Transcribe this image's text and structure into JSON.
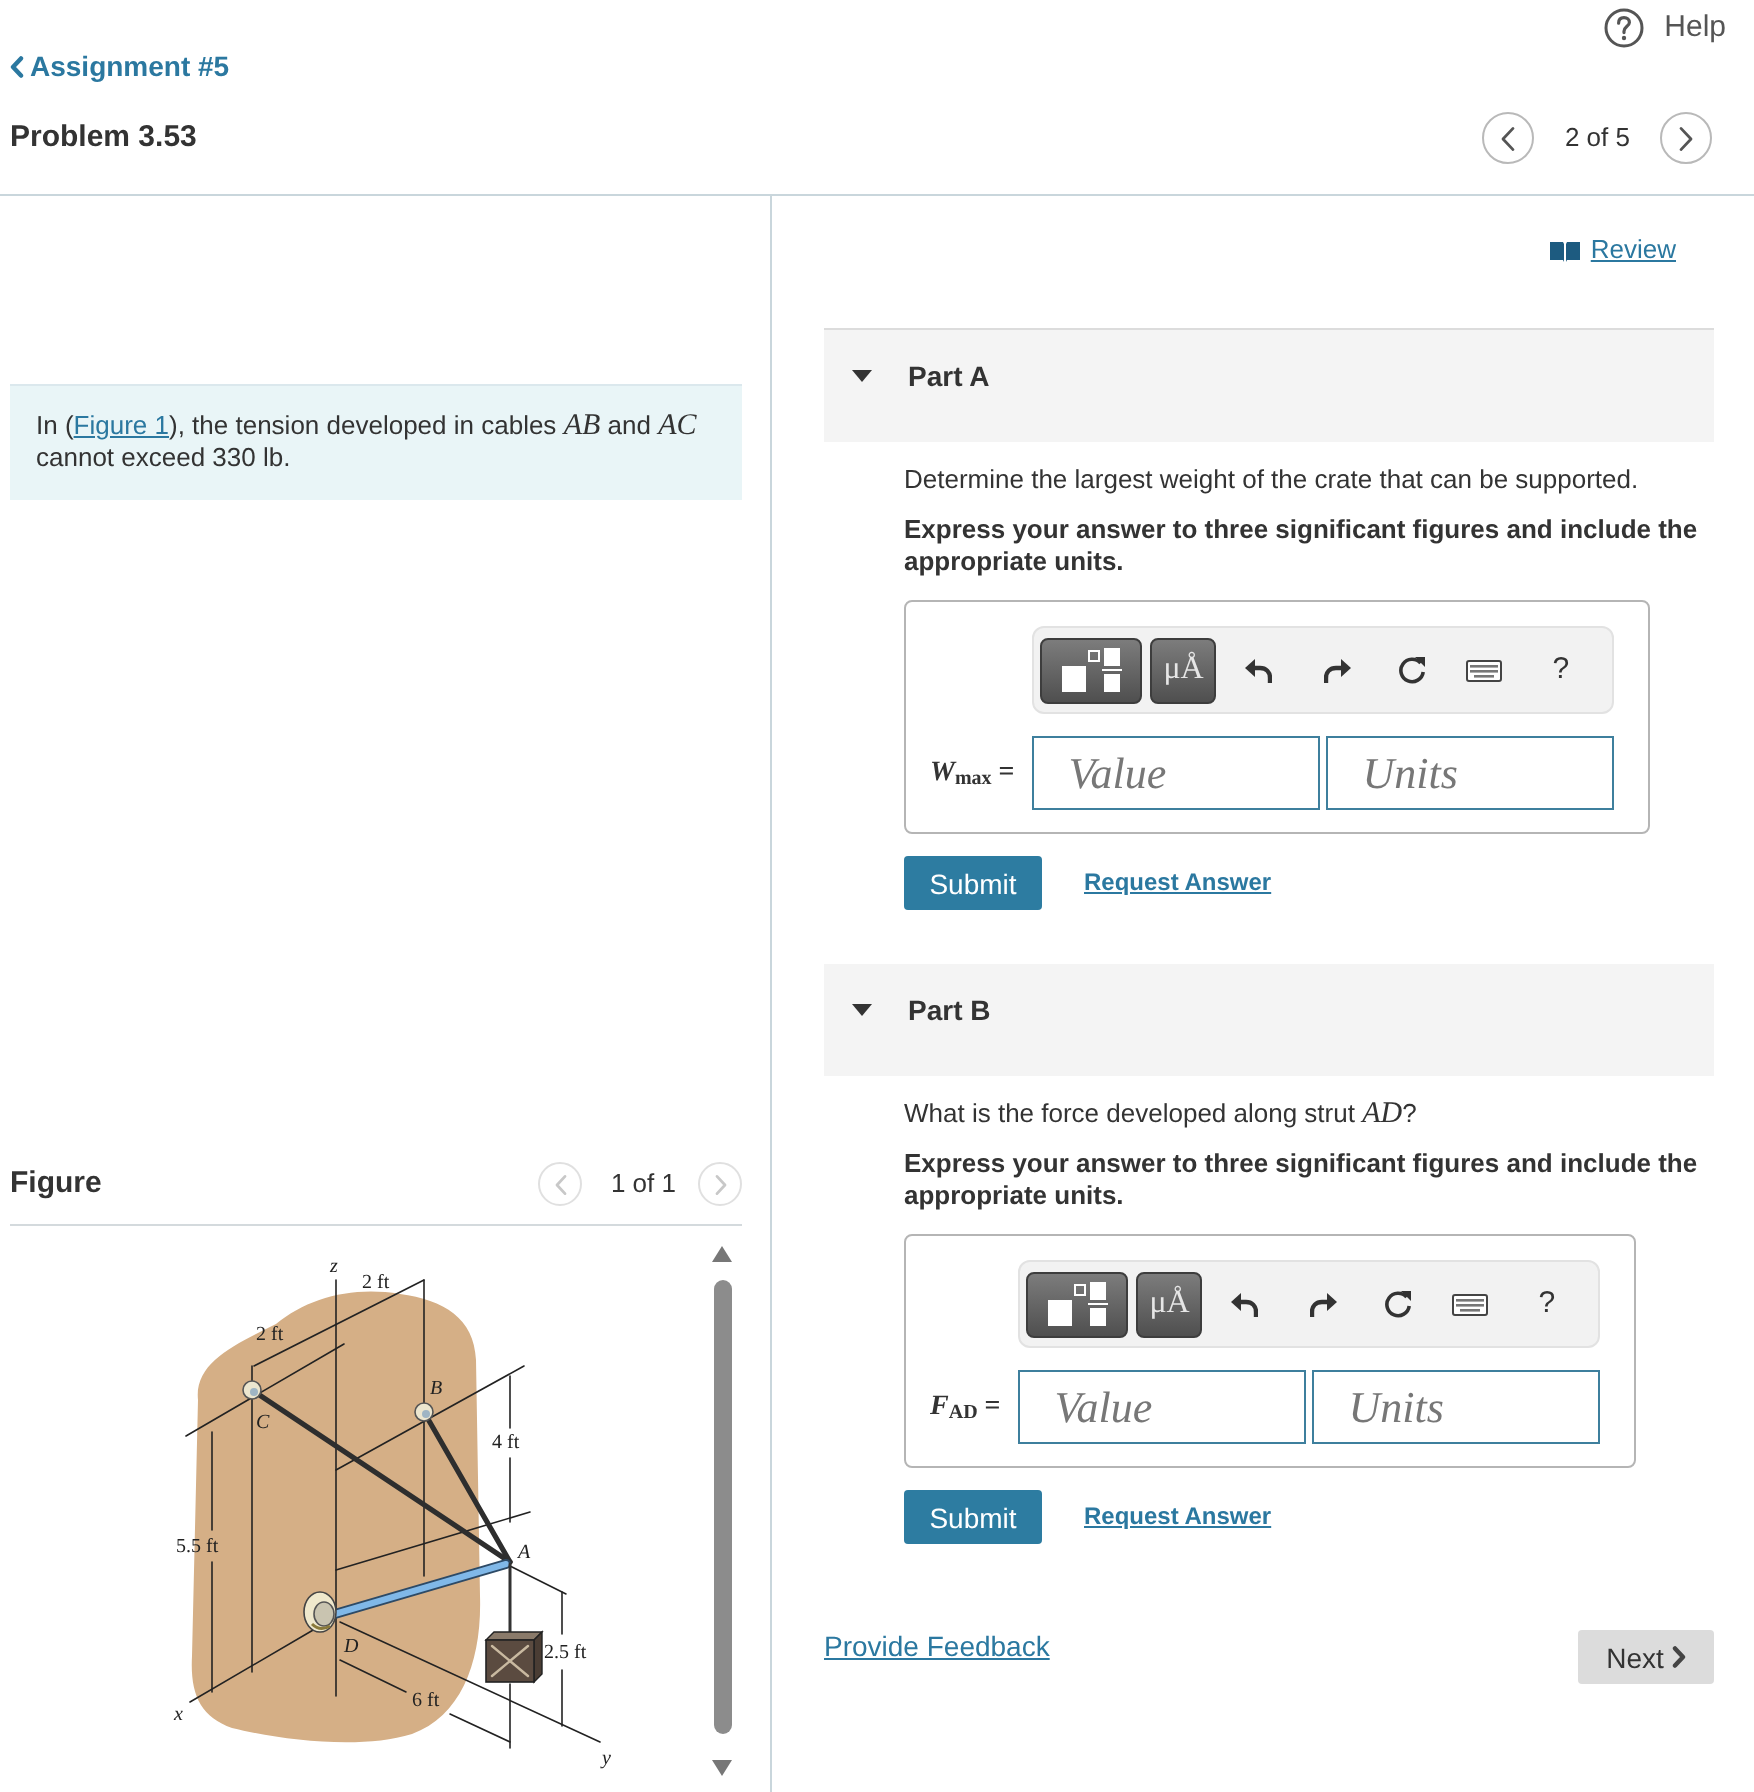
{
  "header": {
    "help": "Help",
    "back_link": "Assignment #5",
    "title": "Problem 3.53",
    "pager": {
      "text": "2 of 5",
      "prev_disabled": false,
      "next_disabled": false
    }
  },
  "problem": {
    "text_start": "In (",
    "figure_link": "Figure 1",
    "text_end": "), the tension developed in cables *AB* and *AC* cannot exceed 330 lb."
  },
  "figure": {
    "title": "Figure",
    "pager": {
      "text": "1 of 1",
      "prev_disabled": true,
      "next_disabled": true
    },
    "labels": [
      {
        "text": "z",
        "kind": "axis"
      },
      {
        "text": "2 ft",
        "kind": "dimension"
      },
      {
        "text": "2 ft",
        "kind": "dimension"
      },
      {
        "text": "B",
        "kind": "point"
      },
      {
        "text": "C",
        "kind": "point"
      },
      {
        "text": "4 ft",
        "kind": "dimension"
      },
      {
        "text": "5.5 ft",
        "kind": "dimension"
      },
      {
        "text": "A",
        "kind": "point"
      },
      {
        "text": "D",
        "kind": "point"
      },
      {
        "text": "2.5 ft",
        "kind": "dimension"
      },
      {
        "text": "6 ft",
        "kind": "dimension"
      },
      {
        "text": "x",
        "kind": "axis"
      },
      {
        "text": "y",
        "kind": "axis"
      }
    ]
  },
  "review_link": "Review",
  "parts": [
    {
      "title": "Part A",
      "expanded": true,
      "question": "Determine the largest weight of the crate that can be supported.",
      "instruction": "Express your answer to three significant figures and include the appropriate units.",
      "symbols_button": "μÅ",
      "help_key": "?",
      "variable": "*W*$_{max}$ =",
      "value_placeholder": "Value",
      "units_placeholder": "Units",
      "submit": "Submit",
      "request_answer": "Request Answer"
    },
    {
      "title": "Part B",
      "expanded": true,
      "question": "What is the force developed along strut *AD*?",
      "instruction": "Express your answer to three significant figures and include the appropriate units.",
      "symbols_button": "μÅ",
      "help_key": "?",
      "variable": "*F*$_{AD}$ =",
      "value_placeholder": "Value",
      "units_placeholder": "Units",
      "submit": "Submit",
      "request_answer": "Request Answer"
    }
  ],
  "feedback_link": "Provide Feedback",
  "next_button": "Next"
}
